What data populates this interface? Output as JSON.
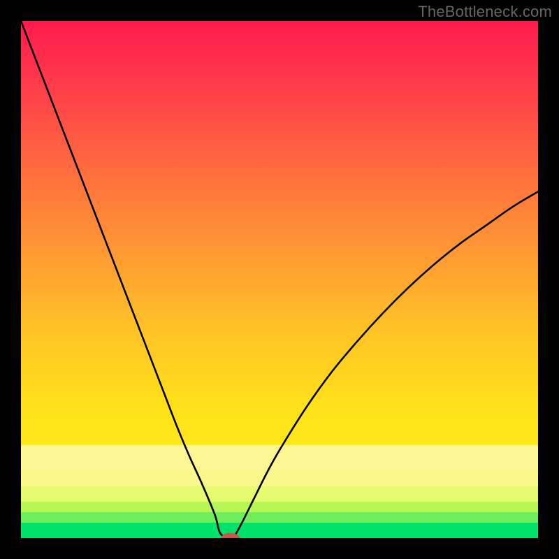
{
  "watermark": "TheBottleneck.com",
  "chart_data": {
    "type": "line",
    "title": "",
    "xlabel": "",
    "ylabel": "",
    "xlim": [
      0,
      100
    ],
    "ylim": [
      0,
      100
    ],
    "grid": false,
    "x": [
      0,
      2.5,
      5,
      7.5,
      10,
      12.5,
      15,
      17.5,
      20,
      22.5,
      25,
      27.5,
      30,
      32.5,
      35,
      37.5,
      38.5,
      40,
      41,
      42.5,
      45,
      47.5,
      50,
      55,
      60,
      65,
      70,
      75,
      80,
      85,
      90,
      95,
      100
    ],
    "values": [
      100,
      93.5,
      87,
      80.5,
      74,
      67.5,
      61,
      54.5,
      48,
      41.5,
      35,
      28.5,
      22,
      16,
      10.5,
      4.5,
      1,
      0,
      0,
      2.5,
      7.5,
      12.5,
      17,
      25,
      32,
      38,
      43.5,
      48.5,
      53,
      57,
      60.5,
      64,
      67
    ],
    "background_bands": [
      {
        "from": 0,
        "to": 3,
        "color": "#00e36b"
      },
      {
        "from": 3,
        "to": 5,
        "color": "#6eee5c"
      },
      {
        "from": 5,
        "to": 7,
        "color": "#b6f655"
      },
      {
        "from": 7,
        "to": 10,
        "color": "#e7fb70"
      },
      {
        "from": 10,
        "to": 13,
        "color": "#faf88a"
      },
      {
        "from": 13,
        "to": 18,
        "color": "#fef693"
      }
    ],
    "marker": {
      "x": 40.5,
      "y": 0,
      "rx": 1.8,
      "ry": 1.0,
      "color": "#c45a4a"
    }
  }
}
